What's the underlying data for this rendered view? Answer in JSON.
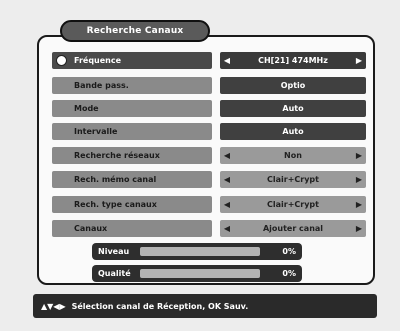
{
  "title": "Recherche Canaux",
  "rows": [
    {
      "label": "Fréquence",
      "value": "CH[21] 474MHz",
      "arrows": true
    },
    {
      "label": "Bande pass.",
      "value": "Optio"
    },
    {
      "label": "Mode",
      "value": "Auto"
    },
    {
      "label": "Intervalle",
      "value": "Auto"
    },
    {
      "label": "Recherche réseaux",
      "value": "Non",
      "arrows": true
    },
    {
      "label": "Rech. mémo canal",
      "value": "Clair+Crypt",
      "arrows": true
    },
    {
      "label": "Rech. type canaux",
      "value": "Clair+Crypt",
      "arrows": true
    },
    {
      "label": "Canaux",
      "value": "Ajouter canal",
      "arrows": true
    }
  ],
  "left_arrow": "◀",
  "right_arrow": "▶",
  "bars": {
    "niveau": {
      "label": "Niveau",
      "percent_text": "0%",
      "level": 0
    },
    "qualite": {
      "label": "Qualité",
      "percent_text": "0%",
      "level": 0
    }
  },
  "footer": {
    "keys": "▲▼◀▶",
    "text": "Sélection canal de Réception, OK Sauv."
  }
}
